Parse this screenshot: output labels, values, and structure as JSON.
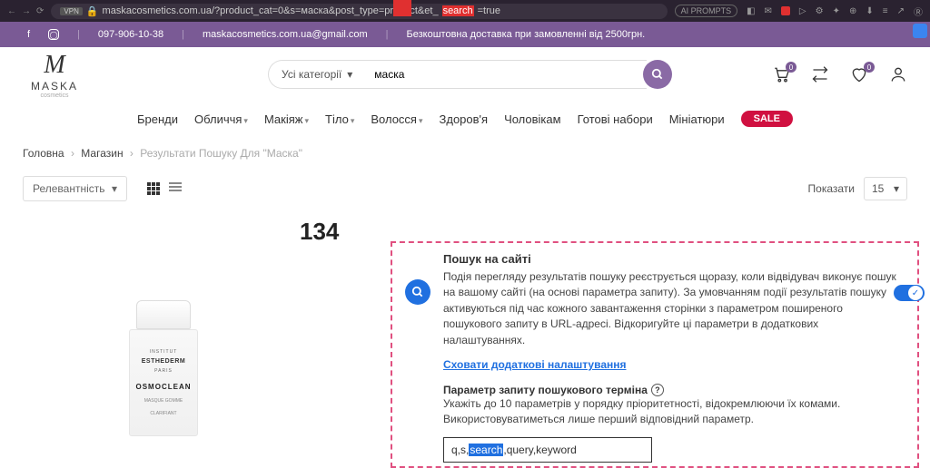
{
  "browser": {
    "url_pre": "maskacosmetics.com.ua/?product_cat=0&s=маска&post_type=product&et_",
    "url_hl": "search",
    "url_post": "=true",
    "ai_label": "AI PROMPTS"
  },
  "topbar": {
    "phone": "097-906-10-38",
    "email": "maskacosmetics.com.ua@gmail.com",
    "shipping": "Безкоштовна доставка при замовленні від 2500грн."
  },
  "logo": {
    "brand": "MASKA",
    "sub": "cosmetics"
  },
  "search": {
    "cat": "Усі категорії",
    "value": "маска"
  },
  "header_icons": {
    "cart_badge": "0",
    "wish_badge": "0"
  },
  "nav": {
    "items": [
      "Бренди",
      "Обличчя",
      "Макіяж",
      "Тіло",
      "Волосся",
      "Здоров'я",
      "Чоловікам",
      "Готові набори",
      "Мініатюри"
    ],
    "sale": "SALE"
  },
  "crumb": {
    "a": "Головна",
    "b": "Магазин",
    "c": "Результати Пошуку Для \"Маска\""
  },
  "toolbar": {
    "sort": "Релевантність",
    "show_label": "Показати",
    "show_val": "15"
  },
  "count": "134",
  "product": {
    "l1": "INSTITUT",
    "l2": "ESTHEDERM",
    "l2b": "PARIS",
    "l3": "OSMOCLEAN",
    "l4a": "MASQUE GOMME",
    "l4b": "CLARIFIANT"
  },
  "panel": {
    "title": "Пошук на сайті",
    "desc": "Подія перегляду результатів пошуку реєструється щоразу, коли відвідувач виконує пошук на вашому сайті (на основі параметра запиту). За умовчанням події результатів пошуку активуються під час кожного завантаження сторінки з параметром поширеного пошукового запиту в URL-адресі. Відкоригуйте ці параметри в додаткових налаштуваннях.",
    "link": "Сховати додаткові налаштування",
    "param_h": "Параметр запиту пошукового терміна",
    "param_desc": "Укажіть до 10 параметрів у порядку пріоритетності, відокремлюючи їх комами. Використовуватиметься лише перший відповідний параметр.",
    "input_pre": "q,s,",
    "input_hl": "search",
    "input_post": ",query,keyword"
  }
}
